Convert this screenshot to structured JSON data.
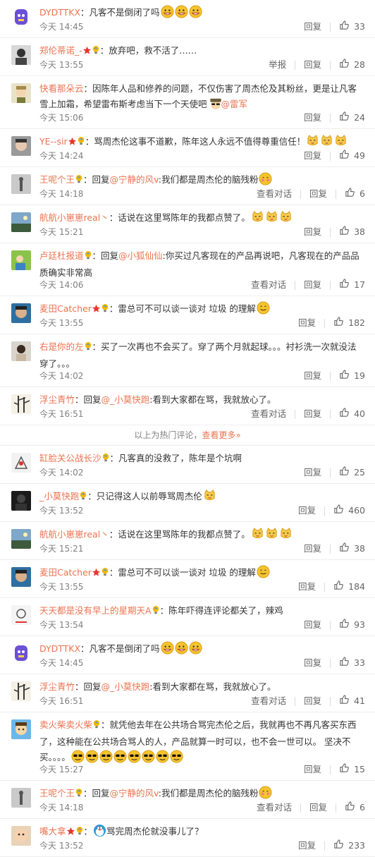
{
  "colors": {
    "name": "#eb7350",
    "text": "#333333",
    "meta": "#808080",
    "accent": "#eb7350",
    "gold": "#f5b800"
  },
  "labels": {
    "reply": "回复",
    "report": "举报",
    "view_thread": "查看对话"
  },
  "divider": {
    "text": "以上为热门评论，",
    "more": "查看更多»"
  },
  "comments_top": [
    {
      "name": "DYDTTKX",
      "body": "：凡客不是倒闭了吗",
      "emojis": [
        "grin",
        "grin",
        "grin"
      ],
      "time": "今天 14:45",
      "actions": [
        "reply"
      ],
      "likes": "33",
      "avatar": "dyd"
    },
    {
      "name": "郑伦蒂诺_-",
      "badges": [
        "star",
        "bulb"
      ],
      "body": "：放弃吧，救不活了……",
      "time": "今天 13:55",
      "actions": [
        "report",
        "reply"
      ],
      "likes": "28",
      "avatar": "person"
    },
    {
      "name": "快看那朵云",
      "body": "：因陈年人品和修养的问题，不仅伤害了周杰伦及其粉丝，更是让凡客雪上加霜，希望雷布斯考虑当下一个天使吧",
      "emojis": [
        "hat"
      ],
      "mention": "@雷军",
      "time": "今天 15:06",
      "actions": [
        "reply"
      ],
      "likes": "24",
      "avatar": "cartoon"
    },
    {
      "name": "YE--sir",
      "badges": [
        "star",
        "bulb"
      ],
      "body": "：骂周杰伦这事不道歉，陈年这人永远不值得尊重信任！",
      "emojis": [
        "cat",
        "cat",
        "cat"
      ],
      "time": "今天 14:24",
      "actions": [
        "reply"
      ],
      "likes": "49",
      "avatar": "face"
    },
    {
      "name": "王呢个王",
      "badges": [
        "bulb"
      ],
      "body_pre": "：回复",
      "mention": "@宁静的风v",
      "body": ":我们都是周杰伦的脑残粉",
      "emojis": [
        "shy"
      ],
      "time": "今天 14:18",
      "actions": [
        "view_thread",
        "reply"
      ],
      "likes": "6",
      "avatar": "gray"
    },
    {
      "name": "航航小崽崽real丶",
      "body": "：话说在这里骂陈年的我都点赞了。",
      "emojis": [
        "cat",
        "cat",
        "cat"
      ],
      "time": "今天 15:21",
      "actions": [
        "reply"
      ],
      "likes": "38",
      "avatar": "scene"
    },
    {
      "name": "卢廷杜报道",
      "badges": [
        "bulb"
      ],
      "body_pre": "：回复",
      "mention": "@小狐仙仙",
      "body": ":你买过凡客现在的产品再说吧，凡客现在的产品品质确实非常高",
      "time": "今天 14:06",
      "actions": [
        "view_thread",
        "reply"
      ],
      "likes": "17",
      "avatar": "green"
    },
    {
      "name": "麦田Catcher",
      "badges": [
        "star",
        "bulb"
      ],
      "body": "：雷总可不可以谈一谈对 垃圾 的理解",
      "emojis": [
        "smile"
      ],
      "time": "今天 13:55",
      "actions": [
        "reply"
      ],
      "likes": "182",
      "avatar": "face2"
    },
    {
      "name": "右是你的左",
      "badges": [
        "bulb"
      ],
      "body": "：买了一次再也不会买了。穿了两个月就起球。。。衬衫洗一次就没法穿了。。。",
      "time": "今天 14:02",
      "actions": [
        "reply"
      ],
      "likes": "19",
      "avatar": "person2"
    },
    {
      "name": "浮尘青竹",
      "body_pre": "：回复",
      "mention": "@_小莫快跑",
      "body": ":看到大家都在骂，我就放心了。",
      "time": "今天 16:51",
      "actions": [
        "view_thread",
        "reply"
      ],
      "likes": "40",
      "avatar": "bamboo"
    }
  ],
  "comments_bottom": [
    {
      "name": "缸脸关公战长沙",
      "badges": [
        "bulb"
      ],
      "body": "：凡客真的没救了，陈年是个坑啊",
      "time": "今天 14:02",
      "actions": [
        "reply"
      ],
      "likes": "25",
      "avatar": "sketch"
    },
    {
      "name": "_小莫快跑",
      "badges": [
        "bulb"
      ],
      "body": "：只记得这人以前辱骂周杰伦",
      "emojis": [
        "cat"
      ],
      "time": "今天 13:52",
      "actions": [
        "reply"
      ],
      "likes": "460",
      "avatar": "dark"
    },
    {
      "name": "航航小崽崽real丶",
      "body": "：话说在这里骂陈年的我都点赞了。",
      "emojis": [
        "cat",
        "cat",
        "cat"
      ],
      "time": "今天 15:21",
      "actions": [
        "reply"
      ],
      "likes": "38",
      "avatar": "scene"
    },
    {
      "name": "麦田Catcher",
      "badges": [
        "star",
        "bulb"
      ],
      "body": "：雷总可不可以谈一谈对 垃圾 的理解",
      "emojis": [
        "smile"
      ],
      "time": "今天 13:55",
      "actions": [
        "reply"
      ],
      "likes": "184",
      "avatar": "face2"
    },
    {
      "name": "天天都是没有早上的星期天A",
      "badges": [
        "bulb"
      ],
      "body": "：陈年吓得连评论都关了，辣鸡",
      "time": "今天 13:54",
      "actions": [
        "reply"
      ],
      "likes": "93",
      "avatar": "sketch2"
    },
    {
      "name": "DYDTTKX",
      "body": "：凡客不是倒闭了吗",
      "emojis": [
        "grin",
        "grin",
        "grin"
      ],
      "time": "今天 14:45",
      "actions": [
        "reply"
      ],
      "likes": "33",
      "avatar": "dyd"
    },
    {
      "name": "浮尘青竹",
      "body_pre": "：回复",
      "mention": "@_小莫快跑",
      "body": ":看到大家都在骂，我就放心了。",
      "time": "今天 16:51",
      "actions": [
        "view_thread",
        "reply"
      ],
      "likes": "41",
      "avatar": "bamboo"
    },
    {
      "name": "卖火柴卖火柴",
      "badges": [
        "bulb"
      ],
      "body": "：就凭他去年在公共场合骂完杰伦之后，我就再也不再凡客买东西了，这种能在公共场合骂人的人，产品就算一时可以，也不会一世可以。 坚决不买。。。。",
      "emojis": [
        "cool",
        "cool",
        "cool",
        "cool",
        "cool",
        "cool",
        "cool",
        "cool"
      ],
      "time": "今天 15:27",
      "actions": [
        "reply"
      ],
      "likes": "15",
      "avatar": "cartoon2"
    },
    {
      "name": "王呢个王",
      "badges": [
        "bulb"
      ],
      "body_pre": "：回复",
      "mention": "@宁静的风v",
      "body": ":我们都是周杰伦的脑残粉",
      "emojis": [
        "shy"
      ],
      "time": "今天 14:18",
      "actions": [
        "view_thread",
        "reply"
      ],
      "likes": "6",
      "avatar": "gray"
    },
    {
      "name": "嘴大拿",
      "badges": [
        "star",
        "bulb"
      ],
      "body_pre": "：",
      "emojis_pre": [
        "doraemon"
      ],
      "body": "骂完周杰伦就没事儿了？",
      "time": "今天 13:52",
      "actions": [
        "reply"
      ],
      "likes": "233",
      "avatar": "baby"
    }
  ]
}
